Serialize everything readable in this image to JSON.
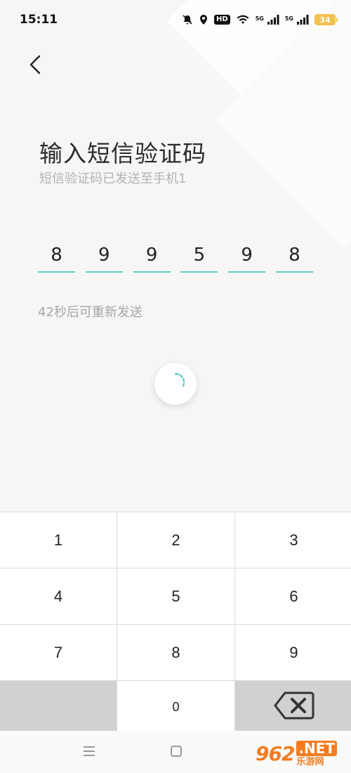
{
  "status_bar": {
    "time": "15:11",
    "hd_label": "HD",
    "signal_label_1": "5G",
    "signal_label_2": "5G",
    "battery": "34"
  },
  "header": {
    "title": "输入短信验证码",
    "subtitle": "短信验证码已发送至手机1"
  },
  "code": {
    "digits": [
      "8",
      "9",
      "9",
      "5",
      "9",
      "8"
    ]
  },
  "resend_text": "42秒后可重新发送",
  "keypad": {
    "keys": [
      "1",
      "2",
      "3",
      "4",
      "5",
      "6",
      "7",
      "8",
      "9",
      "0"
    ]
  },
  "watermark": {
    "logo": "962",
    "net": ".NET",
    "sub": "乐游网"
  },
  "colors": {
    "accent": "#5dcfc4",
    "battery": "#f2c14e"
  }
}
